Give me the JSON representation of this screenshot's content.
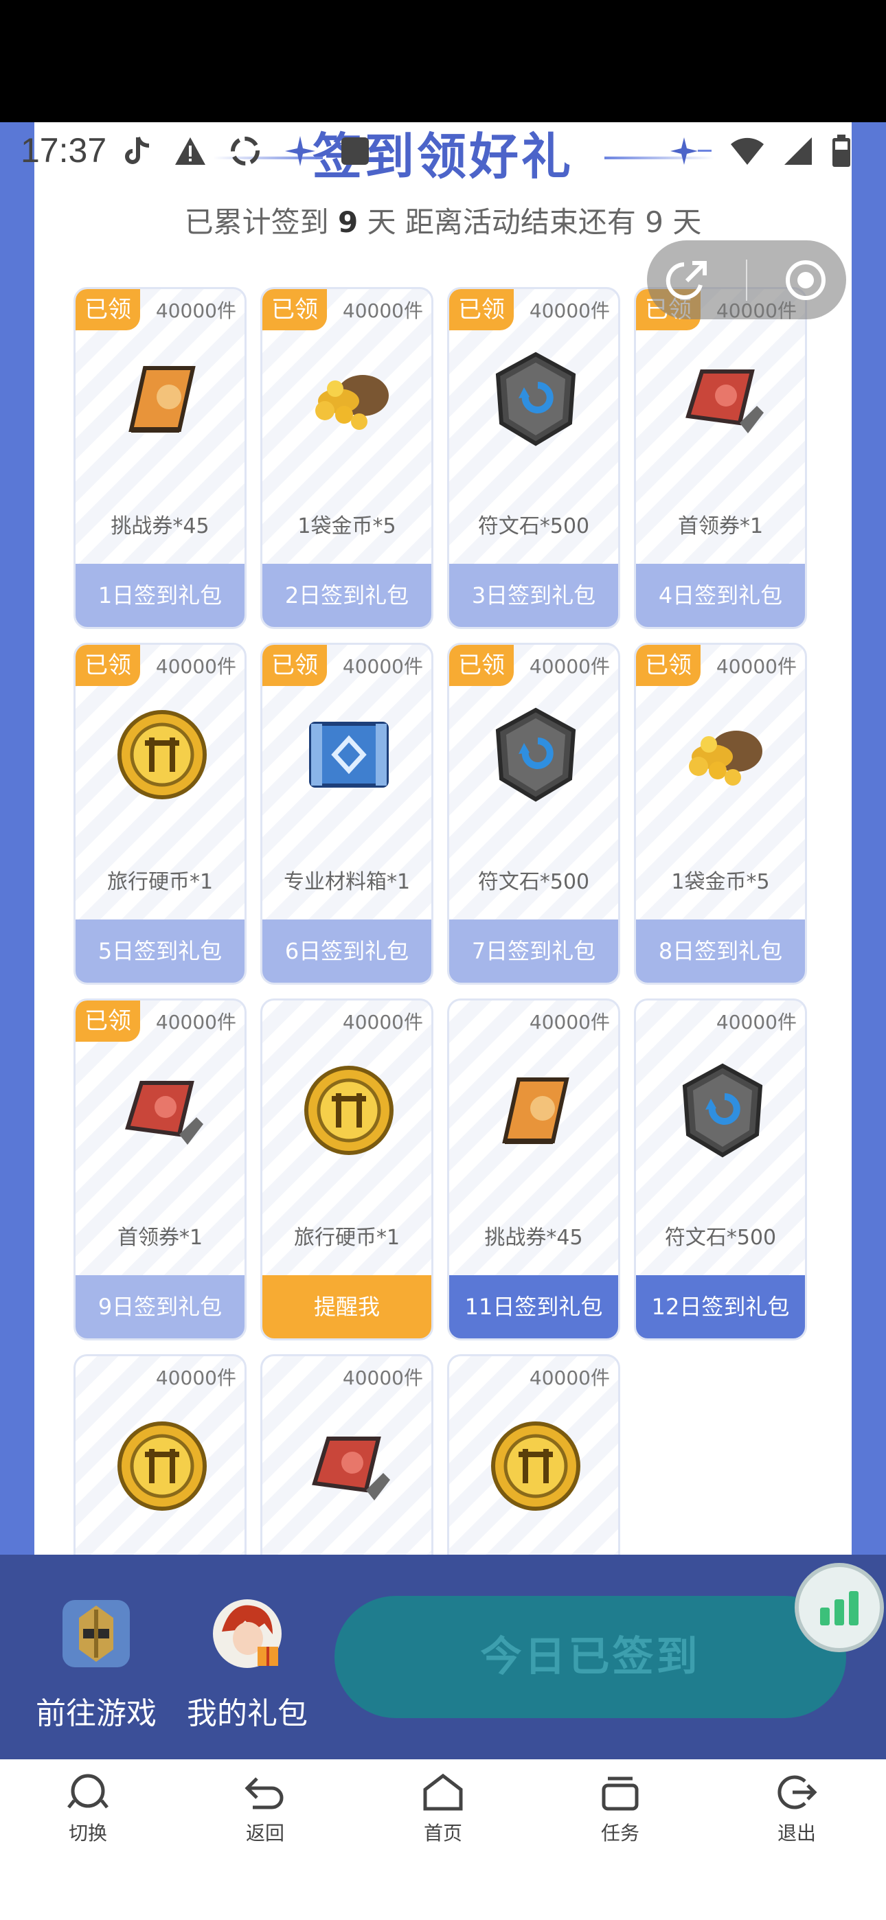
{
  "status_bar": {
    "time": "17:37"
  },
  "header": {
    "title": "签到领好礼",
    "summary_prefix": "已累计签到",
    "summary_days": "9",
    "summary_mid": "天  距离活动结束还有",
    "summary_end_days": "9",
    "summary_suffix": "天"
  },
  "cards": [
    {
      "count": "40000件",
      "name": "挑战券*45",
      "button": "1日签到礼包",
      "claimed": true,
      "icon": "ticket-orange-icon",
      "badge": "已领"
    },
    {
      "count": "40000件",
      "name": "1袋金币*5",
      "button": "2日签到礼包",
      "claimed": true,
      "icon": "gold-bag-icon",
      "badge": "已领"
    },
    {
      "count": "40000件",
      "name": "符文石*500",
      "button": "3日签到礼包",
      "claimed": true,
      "icon": "rune-stone-icon",
      "badge": "已领"
    },
    {
      "count": "40000件",
      "name": "首领券*1",
      "button": "4日签到礼包",
      "claimed": true,
      "icon": "ticket-red-icon",
      "badge": "已领"
    },
    {
      "count": "40000件",
      "name": "旅行硬币*1",
      "button": "5日签到礼包",
      "claimed": true,
      "icon": "travel-coin-icon",
      "badge": "已领"
    },
    {
      "count": "40000件",
      "name": "专业材料箱*1",
      "button": "6日签到礼包",
      "claimed": true,
      "icon": "material-box-icon",
      "badge": "已领"
    },
    {
      "count": "40000件",
      "name": "符文石*500",
      "button": "7日签到礼包",
      "claimed": true,
      "icon": "rune-stone-icon",
      "badge": "已领"
    },
    {
      "count": "40000件",
      "name": "1袋金币*5",
      "button": "8日签到礼包",
      "claimed": true,
      "icon": "gold-bag-icon",
      "badge": "已领"
    },
    {
      "count": "40000件",
      "name": "首领券*1",
      "button": "9日签到礼包",
      "claimed": true,
      "icon": "ticket-red-icon",
      "badge": "已领"
    },
    {
      "count": "40000件",
      "name": "旅行硬币*1",
      "button": "提醒我",
      "claimed": false,
      "icon": "travel-coin-icon",
      "badge": ""
    },
    {
      "count": "40000件",
      "name": "挑战券*45",
      "button": "11日签到礼包",
      "claimed": false,
      "icon": "ticket-orange-icon",
      "badge": ""
    },
    {
      "count": "40000件",
      "name": "符文石*500",
      "button": "12日签到礼包",
      "claimed": false,
      "icon": "rune-stone-icon",
      "badge": ""
    },
    {
      "count": "40000件",
      "name": "",
      "button": "",
      "claimed": false,
      "icon": "travel-coin-icon",
      "badge": ""
    },
    {
      "count": "40000件",
      "name": "",
      "button": "",
      "claimed": false,
      "icon": "ticket-red-icon",
      "badge": ""
    },
    {
      "count": "40000件",
      "name": "",
      "button": "",
      "claimed": false,
      "icon": "travel-coin-icon",
      "badge": ""
    }
  ],
  "bottom": {
    "go_game": "前往游戏",
    "my_gifts": "我的礼包",
    "checkin_button": "今日已签到"
  },
  "navbar": {
    "switch": "切换",
    "back": "返回",
    "home": "首页",
    "tasks": "任务",
    "exit": "退出"
  },
  "colors": {
    "accent": "#5a78d6",
    "badge": "#f7ab33",
    "cta": "#1f7d8e"
  }
}
